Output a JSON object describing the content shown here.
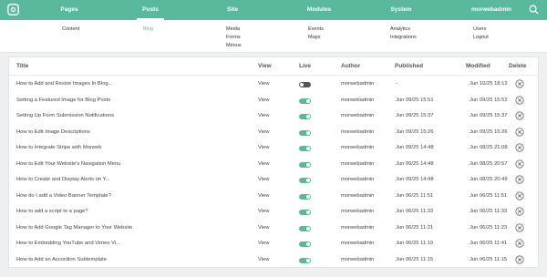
{
  "nav": {
    "items": [
      {
        "label": "Pages",
        "active": false
      },
      {
        "label": "Posts",
        "active": true
      },
      {
        "label": "Site",
        "active": false
      },
      {
        "label": "Modules",
        "active": false
      },
      {
        "label": "System",
        "active": false
      },
      {
        "label": "morwebadmin",
        "active": false
      }
    ]
  },
  "submenu": {
    "pages": [
      "Content"
    ],
    "posts": [
      "Blog"
    ],
    "site": [
      "Media",
      "Forms",
      "Menus"
    ],
    "modules": [
      "Events",
      "Maps"
    ],
    "system": [
      "Analytics",
      "Integrations"
    ],
    "user": [
      "Users",
      "Logout"
    ]
  },
  "table": {
    "headers": {
      "title": "Title",
      "view": "View",
      "live": "Live",
      "author": "Author",
      "published": "Published",
      "modified": "Modified",
      "delete": "Delete"
    },
    "rows": [
      {
        "title": "How to Add and Resize Images In Blog...",
        "view": "View",
        "live": false,
        "author": "morwebadmin",
        "published": "-",
        "modified": "Jun 10/25 18:12"
      },
      {
        "title": "Setting a Featured Image for Blog Posts",
        "view": "View",
        "live": true,
        "author": "morwebadmin",
        "published": "Jun 09/25 15:51",
        "modified": "Jun 09/25 15:52"
      },
      {
        "title": "Setting Up Form Submission Notifications",
        "view": "View",
        "live": true,
        "author": "morwebadmin",
        "published": "Jun 09/25 15:37",
        "modified": "Jun 09/25 15:37"
      },
      {
        "title": "How to Edit Image Descriptions",
        "view": "View",
        "live": true,
        "author": "morwebadmin",
        "published": "Jun 09/25 15:26",
        "modified": "Jun 09/25 15:26"
      },
      {
        "title": "How to Integrate Stripe with Morweb",
        "view": "View",
        "live": true,
        "author": "morwebadmin",
        "published": "Jun 09/25 14:48",
        "modified": "Jun 08/25 21:08"
      },
      {
        "title": "How to Edit Your Website's Navigation Menu",
        "view": "View",
        "live": true,
        "author": "morwebadmin",
        "published": "Jun 09/25 14:48",
        "modified": "Jun 08/25 20:57"
      },
      {
        "title": "How to Create and Display Alerts on Y...",
        "view": "View",
        "live": true,
        "author": "morwebadmin",
        "published": "Jun 09/25 14:48",
        "modified": "Jun 08/25 20:49"
      },
      {
        "title": "How do I add a Video Banner Template?",
        "view": "View",
        "live": true,
        "author": "morwebadmin",
        "published": "Jun 06/25 11:51",
        "modified": "Jun 06/25 11:51"
      },
      {
        "title": "How to add a script to a page?",
        "view": "View",
        "live": true,
        "author": "morwebadmin",
        "published": "Jun 06/25 11:33",
        "modified": "Jun 06/25 11:33"
      },
      {
        "title": "How to Add Google Tag Manager to Your Website",
        "view": "View",
        "live": true,
        "author": "morwebadmin",
        "published": "Jun 06/25 11:21",
        "modified": "Jun 06/25 11:23"
      },
      {
        "title": "How to Embedding YouTube and Vimeo Vi...",
        "view": "View",
        "live": true,
        "author": "morwebadmin",
        "published": "Jun 06/25 11:19",
        "modified": "Jun 06/25 11:41"
      },
      {
        "title": "How to Add an Accordion Subtemplate",
        "view": "View",
        "live": true,
        "author": "morwebadmin",
        "published": "Jun 06/25 11:15",
        "modified": "Jun 06/25 11:15"
      }
    ]
  },
  "colors": {
    "brand": "#5ab89c",
    "toggle_off": "#555555"
  },
  "icons": {
    "logo": "morweb-logo-icon",
    "search": "search-icon",
    "delete": "delete-circle-x-icon"
  }
}
